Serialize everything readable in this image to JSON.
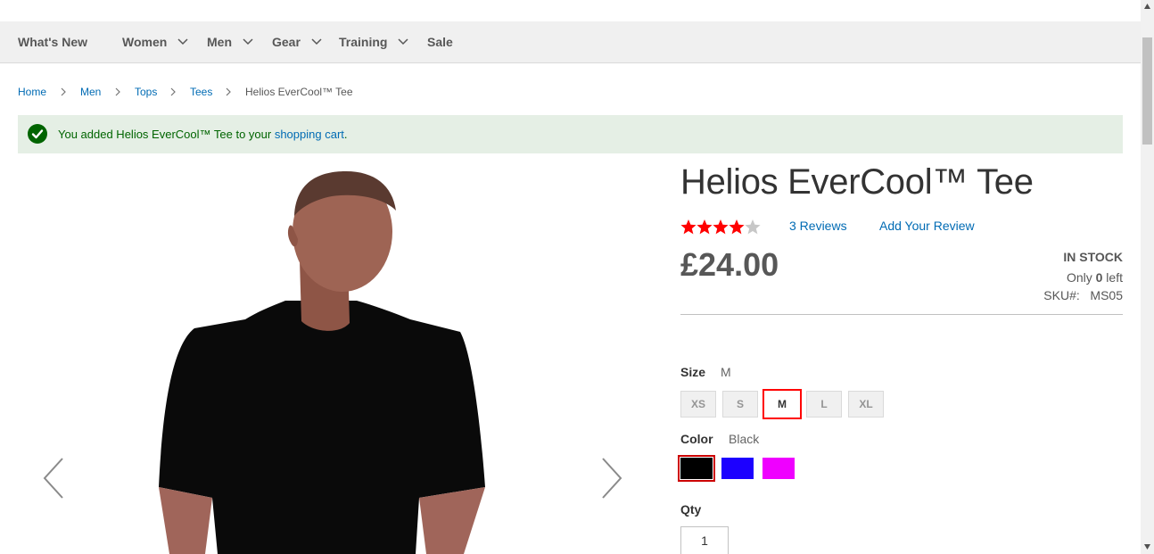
{
  "nav": {
    "items": [
      {
        "label": "What's New",
        "dropdown": false
      },
      {
        "label": "Women",
        "dropdown": true
      },
      {
        "label": "Men",
        "dropdown": true
      },
      {
        "label": "Gear",
        "dropdown": true
      },
      {
        "label": "Training",
        "dropdown": true
      },
      {
        "label": "Sale",
        "dropdown": false
      }
    ]
  },
  "breadcrumb": {
    "items": [
      "Home",
      "Men",
      "Tops",
      "Tees",
      "Helios EverCool™ Tee"
    ]
  },
  "message": {
    "text_before": "You added Helios EverCool™ Tee to your ",
    "link_text": "shopping cart",
    "text_after": "."
  },
  "product": {
    "title": "Helios EverCool™ Tee",
    "rating": {
      "stars_filled": 4,
      "stars_total": 5,
      "star_color": "#ff0000",
      "empty_star_color": "#c7c7c7"
    },
    "reviews_link": "3  Reviews",
    "add_review": "Add Your Review",
    "price": "£24.00",
    "stock_status": "IN STOCK",
    "only_left_prefix": "Only ",
    "only_left_count": "0",
    "only_left_suffix": " left",
    "sku_label": "SKU#:",
    "sku_value": "MS05"
  },
  "options": {
    "size": {
      "label": "Size",
      "selected": "M",
      "choices": [
        "XS",
        "S",
        "M",
        "L",
        "XL"
      ]
    },
    "color": {
      "label": "Color",
      "selected": "Black",
      "choices": [
        {
          "name": "Black",
          "hex": "#000000"
        },
        {
          "name": "Blue",
          "hex": "#1c00ff"
        },
        {
          "name": "Purple",
          "hex": "#ef00ff"
        }
      ]
    },
    "qty": {
      "label": "Qty",
      "value": "1"
    }
  },
  "colors": {
    "link": "#006bb4",
    "success_bg": "#e5efe5",
    "success_text": "#006400",
    "nav_bg": "#f0f0f0"
  },
  "icons": {
    "message": "checkmark-icon",
    "nav_dropdown": "chevron-down-icon",
    "breadcrumb_sep": "chevron-right-icon",
    "gallery_prev": "chevron-left-icon",
    "gallery_next": "chevron-right-icon"
  }
}
